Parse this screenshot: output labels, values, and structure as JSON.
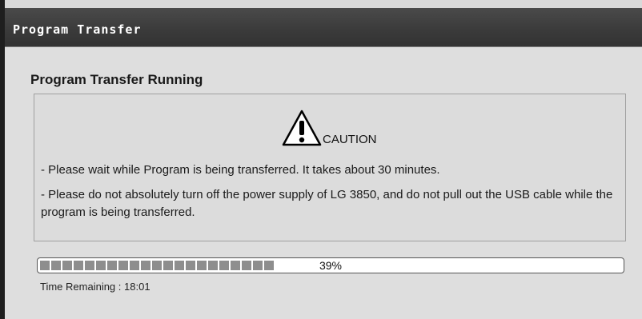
{
  "window": {
    "title": "Program Transfer"
  },
  "dialog": {
    "heading": "Program Transfer Running",
    "caution": {
      "icon": "warning-triangle-icon",
      "label": "CAUTION",
      "messages": [
        "- Please wait while Program is being transferred. It takes about 30 minutes.",
        "- Please do not absolutely turn off the power supply of LG 3850, and do not pull out the USB cable while the program is being transferred."
      ]
    },
    "progress": {
      "percent": 39,
      "label": "39%"
    },
    "time_remaining": {
      "label": "Time Remaining :",
      "value": "18:01"
    }
  },
  "colors": {
    "titlebar": "#3a3a3a",
    "background": "#dedede",
    "progress_fill": "#8e8e8e"
  }
}
